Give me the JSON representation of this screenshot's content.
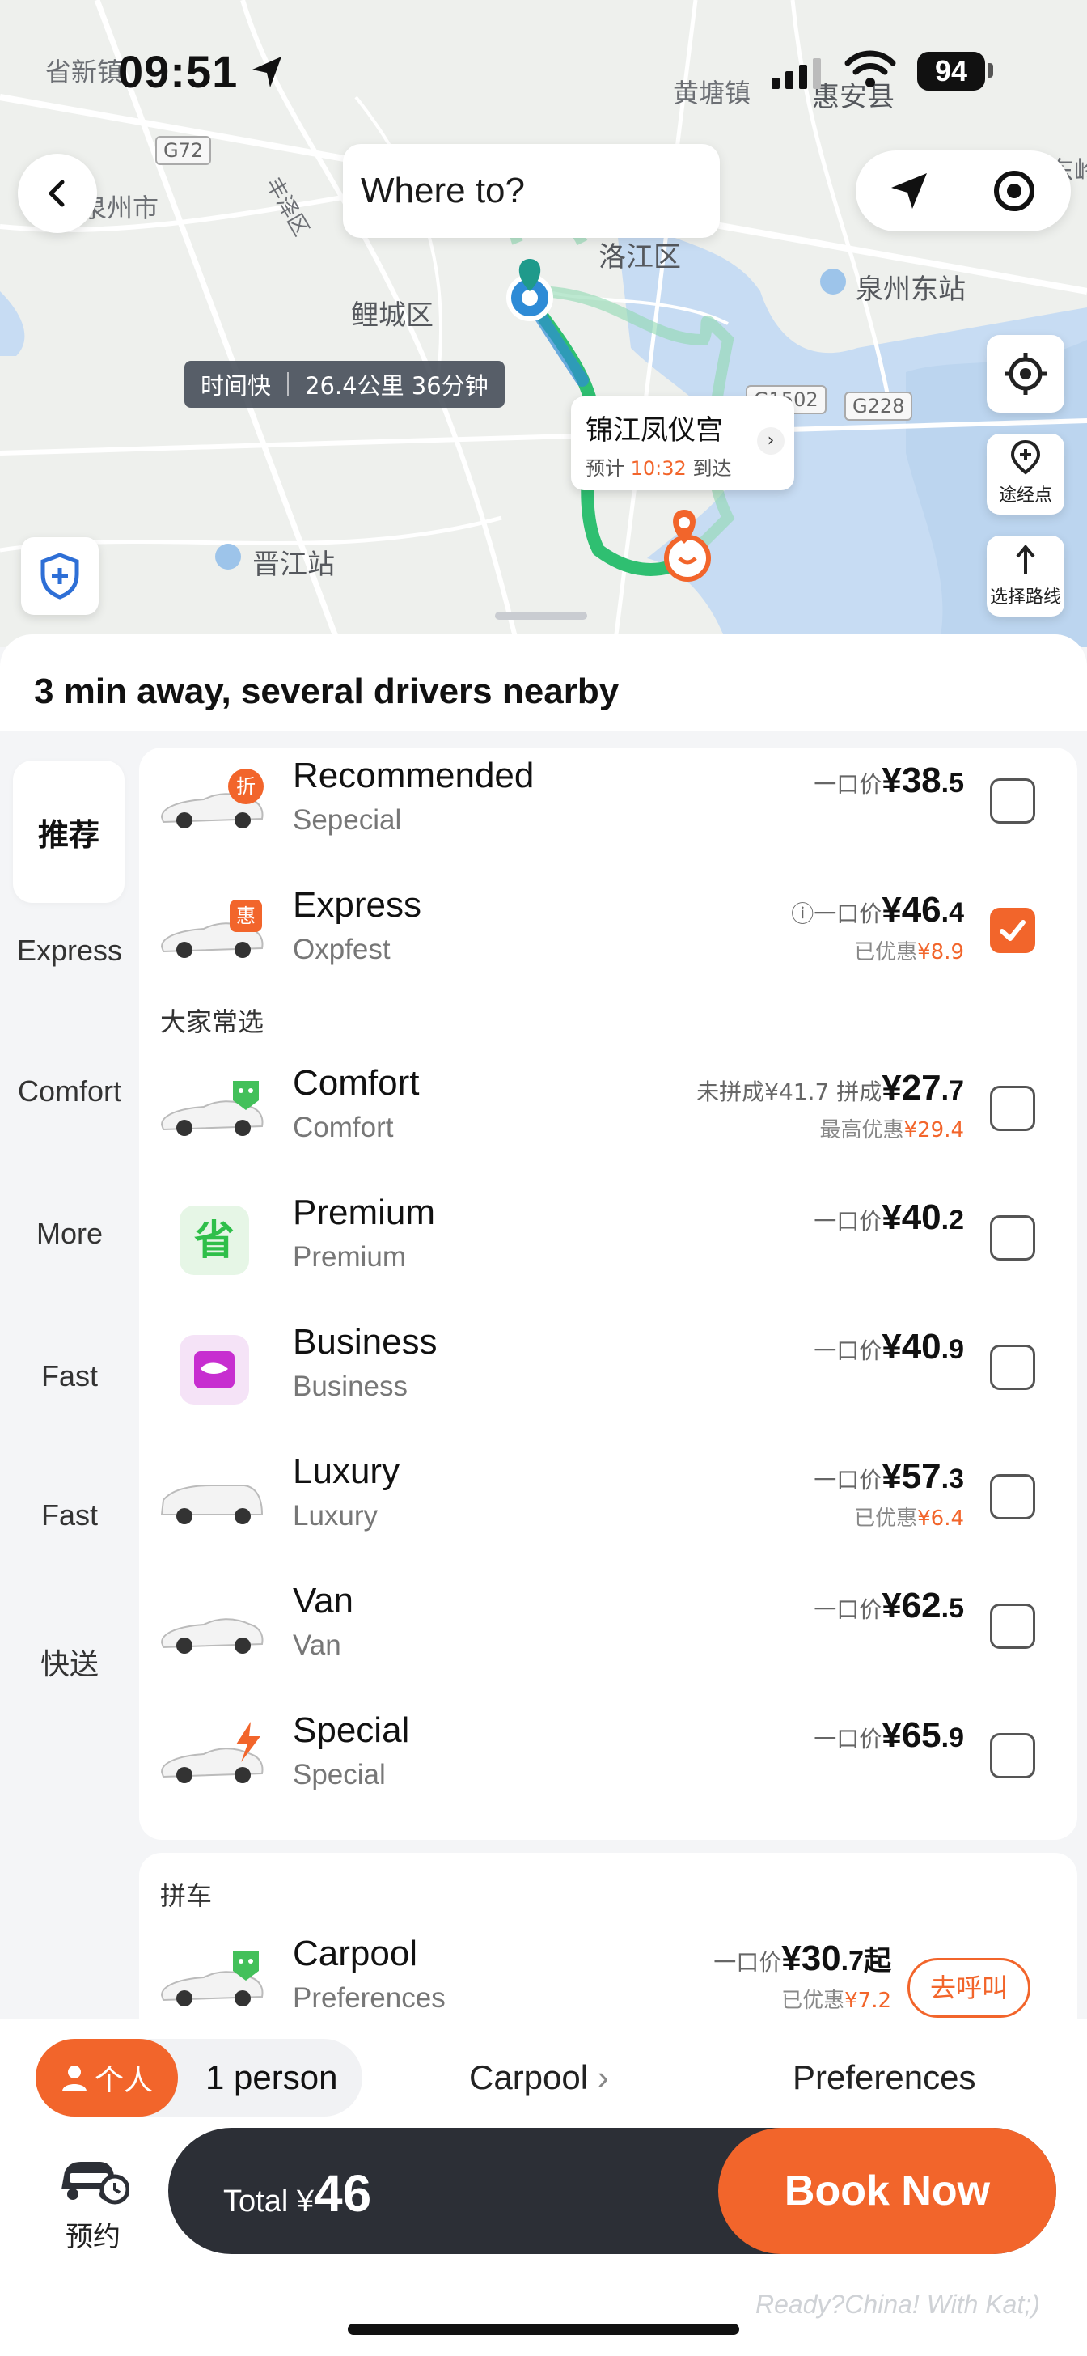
{
  "status": {
    "time": "09:51",
    "battery": "94"
  },
  "map": {
    "labels": [
      "省新镇",
      "黄塘镇",
      "惠安县",
      "泉州东站",
      "洛江区",
      "鲤城区",
      "晋江站",
      "丰泽区",
      "东岭",
      "泉州市"
    ],
    "road_tags": [
      "G72",
      "G1502",
      "G228"
    ],
    "route_badge": {
      "fast": "时间快",
      "distance": "26.4公里 36分钟"
    },
    "destination": {
      "name": "锦江凤仪宫",
      "eta_prefix": "预计",
      "eta_time": "10:32",
      "eta_suffix": "到达"
    },
    "side_buttons": {
      "waypoint": "途经点",
      "route": "选择路线"
    }
  },
  "search": {
    "placeholder": "Where to?"
  },
  "sheet": {
    "title": "3 min away, several drivers nearby"
  },
  "categories": [
    "推荐",
    "Express",
    "Comfort",
    "More",
    "Fast",
    "Fast",
    "快送"
  ],
  "group_label": "大家常选",
  "rides": [
    {
      "name": "Recommended",
      "sub": "Sepecial",
      "price_prefix": "一口价",
      "price_main": "¥38",
      "price_dec": ".5",
      "selected": false
    },
    {
      "name": "Express",
      "sub": "Oxpfest",
      "price_prefix": "一口价",
      "price_main": "¥46",
      "price_dec": ".4",
      "discount_label": "已优惠",
      "discount": "¥8.9",
      "selected": true
    },
    {
      "name": "Comfort",
      "sub": "Comfort",
      "price_prefix": "未拼成¥41.7 拼成",
      "price_main": "¥27",
      "price_dec": ".7",
      "discount_label": "最高优惠",
      "discount": "¥29.4",
      "selected": false
    },
    {
      "name": "Premium",
      "sub": "Premium",
      "price_prefix": "一口价",
      "price_main": "¥40",
      "price_dec": ".2",
      "selected": false
    },
    {
      "name": "Business",
      "sub": "Business",
      "price_prefix": "一口价",
      "price_main": "¥40",
      "price_dec": ".9",
      "selected": false
    },
    {
      "name": "Luxury",
      "sub": "Luxury",
      "price_prefix": "一口价",
      "price_main": "¥57",
      "price_dec": ".3",
      "discount_label": "已优惠",
      "discount": "¥6.4",
      "selected": false
    },
    {
      "name": "Van",
      "sub": "Van",
      "price_prefix": "一口价",
      "price_main": "¥62",
      "price_dec": ".5",
      "selected": false
    },
    {
      "name": "Special",
      "sub": "Special",
      "price_prefix": "一口价",
      "price_main": "¥65",
      "price_dec": ".9",
      "selected": false
    }
  ],
  "carpool": {
    "section": "拼车",
    "name": "Carpool",
    "sub": "Preferences",
    "price_prefix": "一口价",
    "price_main": "¥30",
    "price_dec": ".7起",
    "discount_label": "已优惠",
    "discount": "¥7.2",
    "call": "去呼叫"
  },
  "bottom": {
    "person_tag": "个人",
    "person_count": "1 person",
    "carpool": "Carpool",
    "preferences": "Preferences",
    "reserve": "预约",
    "total_label": "Total ¥",
    "total_value": "46",
    "book": "Book Now",
    "watermark": "Ready?China! With Kat;)"
  },
  "colors": {
    "accent": "#f2652b",
    "route": "#2fbf71",
    "dark": "#2c2f36"
  }
}
